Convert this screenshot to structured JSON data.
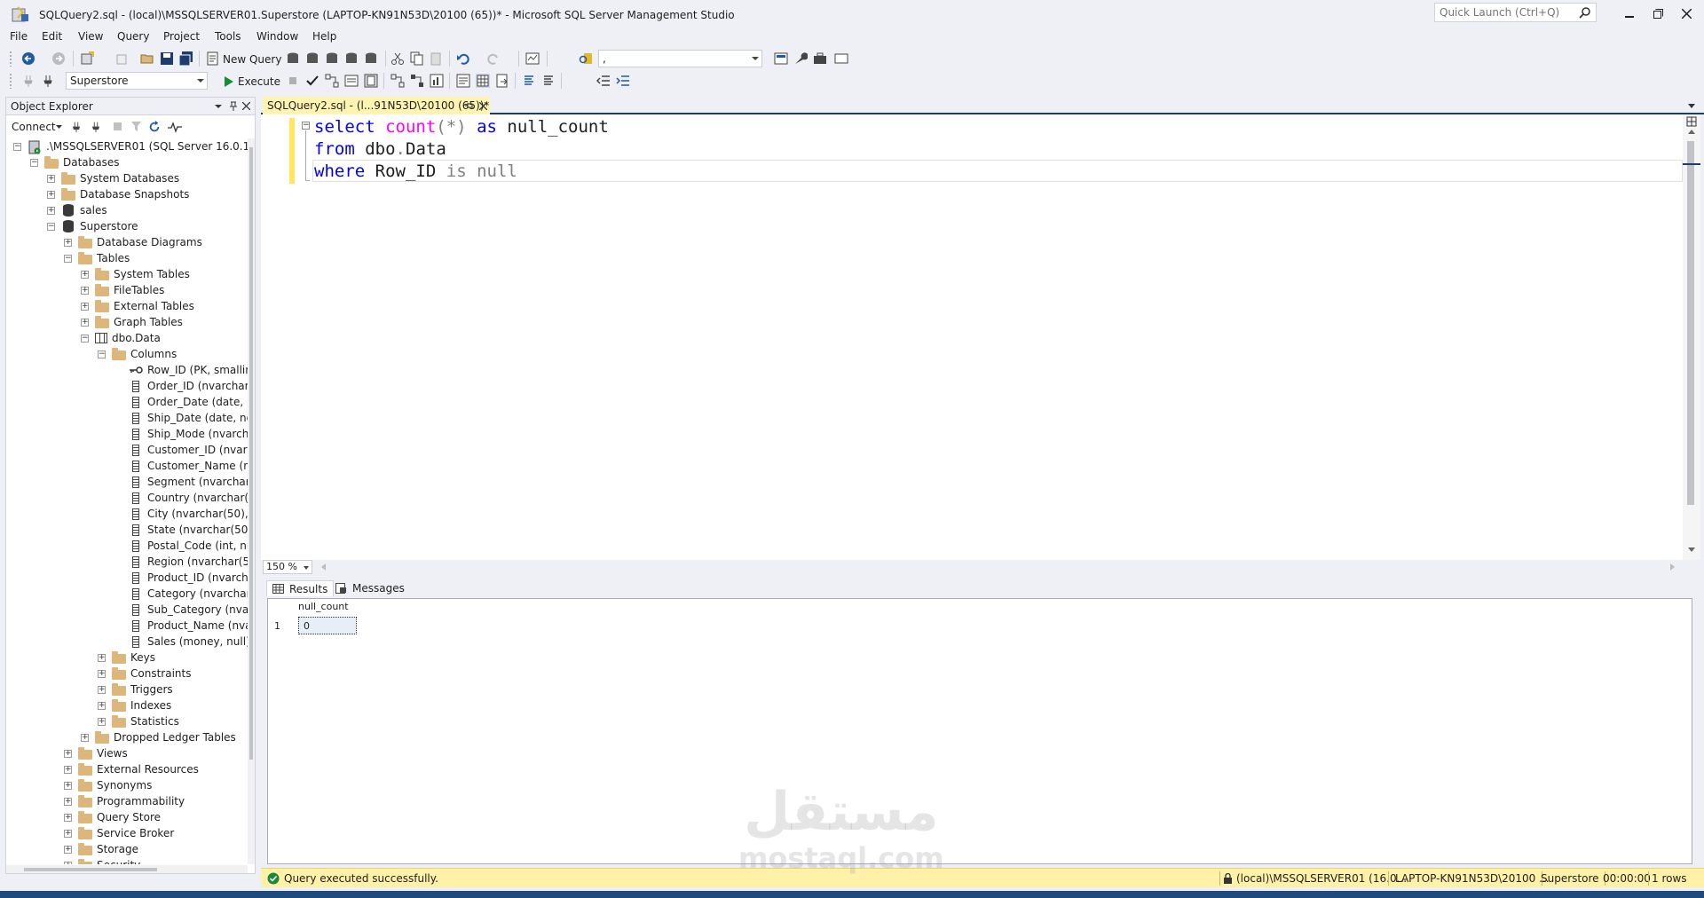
{
  "window": {
    "title": "SQLQuery2.sql - (local)\\MSSQLSERVER01.Superstore (LAPTOP-KN91N53D\\20100 (65))* - Microsoft SQL Server Management Studio",
    "quick_launch_placeholder": "Quick Launch (Ctrl+Q)"
  },
  "menu": [
    "File",
    "Edit",
    "View",
    "Query",
    "Project",
    "Tools",
    "Window",
    "Help"
  ],
  "toolbar1": {
    "new_query_label": "New Query",
    "solution_combo_value": ","
  },
  "toolbar2": {
    "database_combo_value": "Superstore",
    "execute_label": "Execute"
  },
  "object_explorer": {
    "title": "Object Explorer",
    "connect_label": "Connect",
    "nodes": [
      {
        "label": ".\\MSSQLSERVER01 (SQL Server 16.0.1000.6"
      },
      {
        "label": "Databases"
      },
      {
        "label": "System Databases"
      },
      {
        "label": "Database Snapshots"
      },
      {
        "label": "sales"
      },
      {
        "label": "Superstore"
      },
      {
        "label": "Database Diagrams"
      },
      {
        "label": "Tables"
      },
      {
        "label": "System Tables"
      },
      {
        "label": "FileTables"
      },
      {
        "label": "External Tables"
      },
      {
        "label": "Graph Tables"
      },
      {
        "label": "dbo.Data"
      },
      {
        "label": "Columns"
      },
      {
        "label": "Row_ID (PK, smallin"
      },
      {
        "label": "Order_ID (nvarchar("
      },
      {
        "label": "Order_Date (date, n"
      },
      {
        "label": "Ship_Date (date, not"
      },
      {
        "label": "Ship_Mode (nvarcha"
      },
      {
        "label": "Customer_ID (nvarc"
      },
      {
        "label": "Customer_Name (n"
      },
      {
        "label": "Segment (nvarchar("
      },
      {
        "label": "Country (nvarchar(5"
      },
      {
        "label": "City (nvarchar(50), r"
      },
      {
        "label": "State (nvarchar(50),"
      },
      {
        "label": "Postal_Code (int, nu"
      },
      {
        "label": "Region (nvarchar(50"
      },
      {
        "label": "Product_ID (nvarcha"
      },
      {
        "label": "Category (nvarchar("
      },
      {
        "label": "Sub_Category (nvar"
      },
      {
        "label": "Product_Name (nva"
      },
      {
        "label": "Sales (money, null)"
      },
      {
        "label": "Keys"
      },
      {
        "label": "Constraints"
      },
      {
        "label": "Triggers"
      },
      {
        "label": "Indexes"
      },
      {
        "label": "Statistics"
      },
      {
        "label": "Dropped Ledger Tables"
      },
      {
        "label": "Views"
      },
      {
        "label": "External Resources"
      },
      {
        "label": "Synonyms"
      },
      {
        "label": "Programmability"
      },
      {
        "label": "Query Store"
      },
      {
        "label": "Service Broker"
      },
      {
        "label": "Storage"
      },
      {
        "label": "Security"
      }
    ]
  },
  "document": {
    "tab_label": "SQLQuery2.sql - (l...91N53D\\20100 (65))*",
    "code": {
      "line1": {
        "kw1": "select",
        "fn": "count",
        "args": "(*)",
        "kw2": "as",
        "alias": "null_count"
      },
      "line2": {
        "kw": "from",
        "schema": "dbo",
        "dot": ".",
        "table": "Data"
      },
      "line3": {
        "kw": "where",
        "col": "Row_ID",
        "op": "is null"
      }
    },
    "zoom": "150 %"
  },
  "results": {
    "tab_results": "Results",
    "tab_messages": "Messages",
    "column_header": "null_count",
    "row_number": "1",
    "cell_value": "0"
  },
  "status": {
    "message": "Query executed successfully.",
    "server": "(local)\\MSSQLSERVER01 (16.0...",
    "user": "LAPTOP-KN91N53D\\20100 ...",
    "database": "Superstore",
    "elapsed": "00:00:00",
    "rows": "1 rows"
  },
  "watermark": {
    "arabic": "مستقل",
    "latin": "mostaql.com"
  },
  "colors": {
    "accent": "#1e3c6e",
    "tab_active": "#fff3b1",
    "status_bg": "#fff2a8",
    "keyword": "#0000ff",
    "function": "#ff00ff"
  }
}
